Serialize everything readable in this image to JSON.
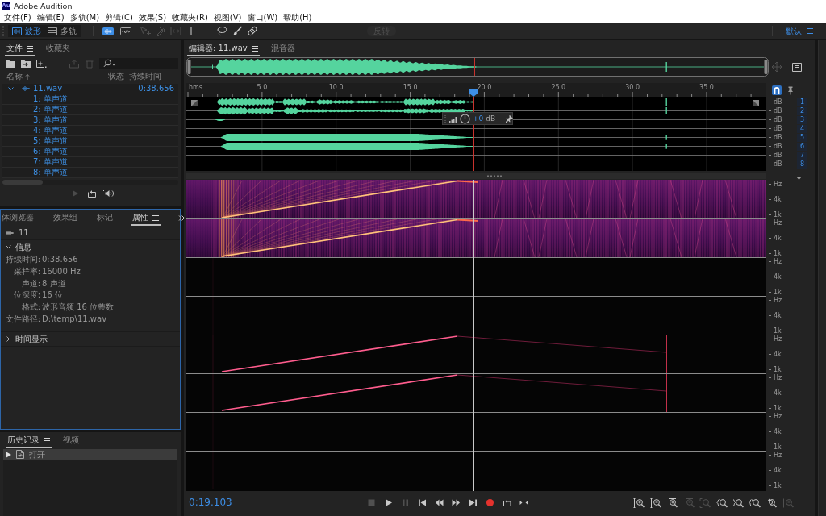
{
  "title_bar": {
    "logo": "Au",
    "title": "Adobe Audition"
  },
  "menu_bar": [
    "文件(F)",
    "编辑(E)",
    "多轨(M)",
    "剪辑(C)",
    "效果(S)",
    "收藏夹(R)",
    "视图(V)",
    "窗口(W)",
    "帮助(H)"
  ],
  "toolbar": {
    "views": [
      {
        "label": "波形",
        "selected": true
      },
      {
        "label": "多轨",
        "selected": false
      }
    ],
    "displays": [
      {
        "kind": "waveform",
        "selected": true
      },
      {
        "kind": "spectral",
        "selected": false
      }
    ],
    "tools": [
      {
        "kind": "move",
        "selected": false,
        "disabled": true
      },
      {
        "kind": "razor",
        "selected": false,
        "disabled": true
      },
      {
        "kind": "slip",
        "selected": false,
        "disabled": true
      },
      {
        "kind": "time",
        "selected": false,
        "disabled": false
      },
      {
        "kind": "marquee",
        "selected": true,
        "disabled": false
      },
      {
        "kind": "lasso",
        "selected": false,
        "disabled": false
      },
      {
        "kind": "brush",
        "selected": false,
        "disabled": false
      },
      {
        "kind": "healing",
        "selected": false,
        "disabled": false
      }
    ],
    "action_button": {
      "label": "反转",
      "disabled": true
    },
    "workspace": "默认"
  },
  "files_panel": {
    "tabs": [
      {
        "label": "文件",
        "selected": true
      },
      {
        "label": "收藏夹",
        "selected": false
      }
    ],
    "tools": [
      {
        "kind": "open",
        "disabled": false
      },
      {
        "kind": "import",
        "disabled": false
      },
      {
        "kind": "new",
        "disabled": false
      },
      {
        "kind": "insert",
        "disabled": true
      },
      {
        "kind": "delete",
        "disabled": true
      }
    ],
    "columns": [
      "名称",
      "状态",
      "持续时间"
    ],
    "items": [
      {
        "name": "11.wav",
        "duration": "0:38.656",
        "expanded": true,
        "children": [
          {
            "name": "1: 单声道"
          },
          {
            "name": "2: 单声道"
          },
          {
            "name": "3: 单声道"
          },
          {
            "name": "4: 单声道"
          },
          {
            "name": "5: 单声道"
          },
          {
            "name": "6: 单声道"
          },
          {
            "name": "7: 单声道"
          },
          {
            "name": "8: 单声道"
          }
        ]
      }
    ],
    "footer": [
      {
        "kind": "play",
        "disabled": true
      },
      {
        "kind": "loop",
        "disabled": false
      },
      {
        "kind": "autoplay",
        "disabled": false
      }
    ]
  },
  "properties_panel": {
    "focused": true,
    "tabs": [
      {
        "label": "体浏览器",
        "selected": false
      },
      {
        "label": "效果组",
        "selected": false
      },
      {
        "label": "标记",
        "selected": false
      },
      {
        "label": "属性",
        "selected": true
      }
    ],
    "item": "11",
    "sections": [
      {
        "title": "信息",
        "expanded": true,
        "fields": [
          {
            "label": "持续时间:",
            "value": "0:38.656"
          },
          {
            "label": "采样率:",
            "value": "16000 Hz"
          },
          {
            "label": "声道:",
            "value": "8 声道"
          },
          {
            "label": "位深度:",
            "value": "16 位"
          },
          {
            "label": "格式:",
            "value": "波形音频 16 位整数"
          },
          {
            "label": "文件路径:",
            "value": "D:\\temp\\11.wav"
          }
        ]
      },
      {
        "title": "时间显示",
        "expanded": false
      }
    ]
  },
  "history_panel": {
    "tabs": [
      {
        "label": "历史记录",
        "selected": true
      },
      {
        "label": "视频",
        "selected": false
      }
    ],
    "items": [
      {
        "label": "打开",
        "selected": true
      }
    ]
  },
  "editor": {
    "tabs": [
      {
        "label": "编辑器: 11.wav",
        "selected": true
      },
      {
        "label": "混音器",
        "selected": false
      }
    ],
    "overview_tools": [
      {
        "kind": "navigate",
        "disabled": true
      },
      {
        "kind": "menu",
        "disabled": false
      }
    ],
    "ruler": {
      "unit": "hms",
      "labels": [
        "5.0",
        "10.0",
        "15.0",
        "20.0",
        "25.0",
        "30.0",
        "35.0"
      ]
    },
    "ruler_tools": [
      {
        "kind": "snap",
        "selected": true
      },
      {
        "kind": "pin",
        "selected": false
      }
    ],
    "channels": [
      {
        "unit": "dB",
        "number": "1",
        "enabled": true
      },
      {
        "unit": "dB",
        "number": "2",
        "enabled": true
      },
      {
        "unit": "dB",
        "number": "3",
        "enabled": true
      },
      {
        "unit": "dB",
        "number": "4",
        "enabled": true
      },
      {
        "unit": "dB",
        "number": "5",
        "enabled": true
      },
      {
        "unit": "dB",
        "number": "6",
        "enabled": true
      },
      {
        "unit": "dB",
        "number": "7",
        "enabled": true
      },
      {
        "unit": "dB",
        "number": "8",
        "enabled": true
      }
    ],
    "hud": {
      "gain": "+0",
      "unit": "dB"
    },
    "spectral_channels": [
      {
        "labels": [
          "Hz",
          "4k",
          "1k"
        ]
      },
      {
        "labels": [
          "Hz",
          "4k",
          "1k"
        ]
      },
      {
        "labels": [
          "Hz",
          "4k",
          "1k"
        ]
      },
      {
        "labels": [
          "Hz",
          "4k",
          "1k"
        ]
      },
      {
        "labels": [
          "Hz",
          "4k",
          "1k"
        ]
      },
      {
        "labels": [
          "Hz",
          "4k",
          "1k"
        ]
      },
      {
        "labels": [
          "Hz",
          "4k",
          "1k"
        ]
      },
      {
        "labels": [
          "Hz",
          "4k",
          "1k"
        ]
      }
    ]
  },
  "transport": {
    "time": "0:19.103",
    "buttons": [
      {
        "kind": "stop",
        "disabled": true
      },
      {
        "kind": "play",
        "disabled": false
      },
      {
        "kind": "pause",
        "disabled": true
      },
      {
        "kind": "previous",
        "disabled": false
      },
      {
        "kind": "rewind",
        "disabled": false
      },
      {
        "kind": "forward",
        "disabled": false
      },
      {
        "kind": "next",
        "disabled": false
      },
      {
        "kind": "record",
        "disabled": false
      },
      {
        "kind": "loop",
        "disabled": false
      },
      {
        "kind": "skip",
        "disabled": false
      }
    ],
    "zoom_buttons": [
      {
        "kind": "ampin",
        "disabled": false
      },
      {
        "kind": "ampout",
        "disabled": false
      },
      {
        "kind": "timein",
        "disabled": false
      },
      {
        "kind": "timeout",
        "disabled": true
      },
      {
        "kind": "full",
        "disabled": true
      },
      {
        "kind": "inpoint",
        "disabled": false
      },
      {
        "kind": "outpoint",
        "disabled": false
      },
      {
        "kind": "selection",
        "disabled": false
      },
      {
        "kind": "reset",
        "disabled": false
      },
      {
        "kind": "limit",
        "disabled": true
      }
    ]
  }
}
